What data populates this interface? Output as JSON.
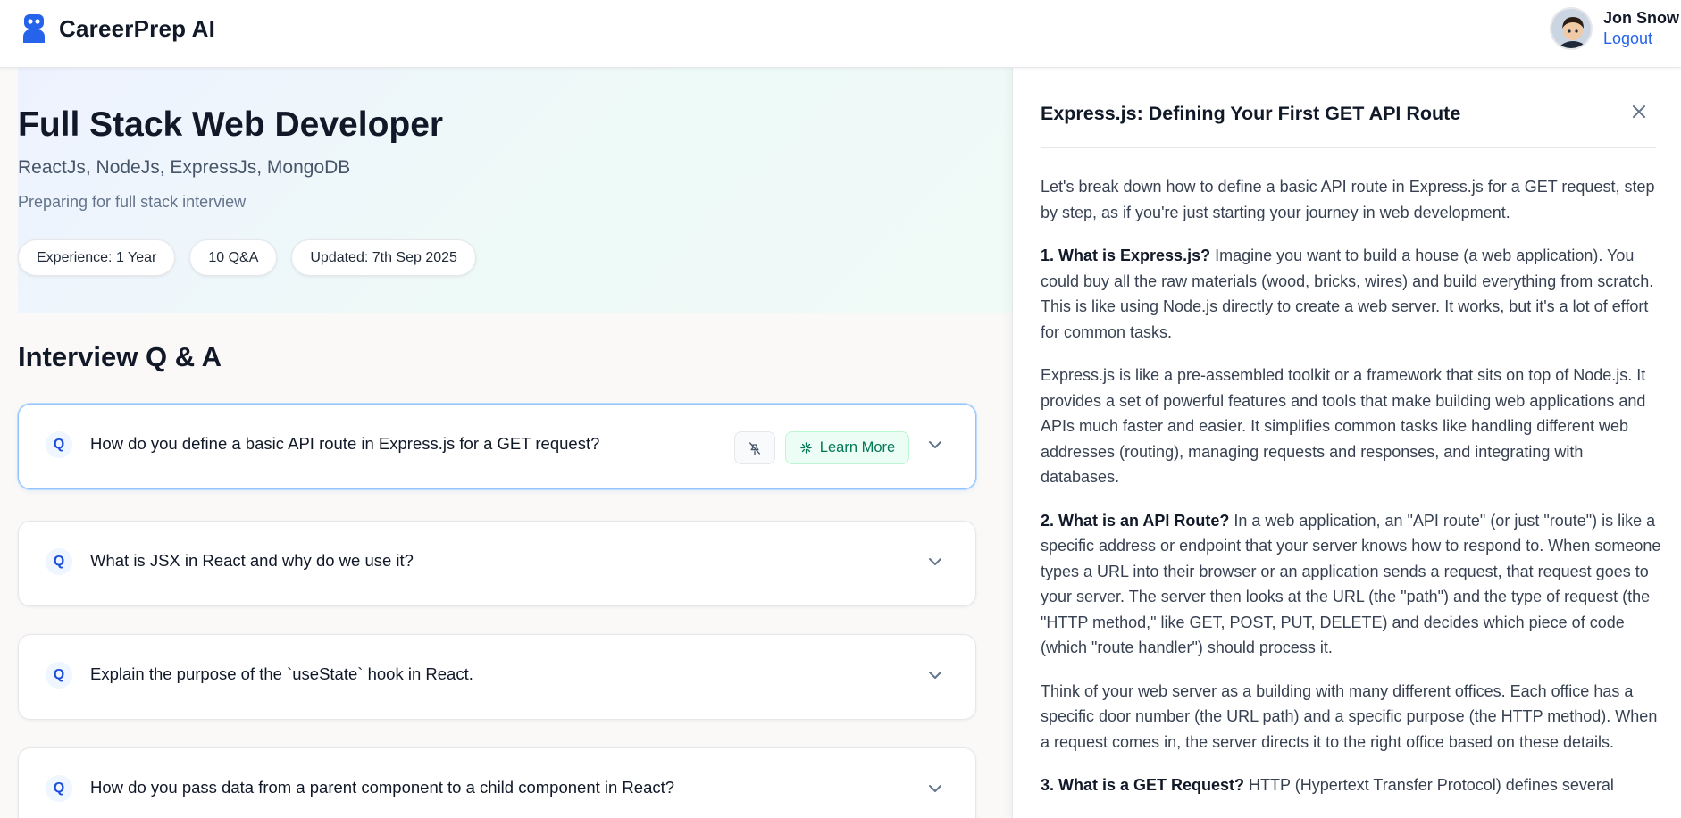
{
  "app": {
    "name": "CareerPrep AI"
  },
  "user": {
    "name": "Jon Snow",
    "logout_label": "Logout"
  },
  "session": {
    "role": "Full Stack Web Developer",
    "skills": "ReactJs, NodeJs, ExpressJs, MongoDB",
    "description": "Preparing for full stack interview",
    "chips": [
      "Experience: 1 Year",
      "10 Q&A",
      "Updated: 7th Sep 2025"
    ]
  },
  "qa": {
    "heading": "Interview Q & A",
    "badge": "Q",
    "learn_more_label": "Learn More",
    "items": [
      {
        "question": "How do you define a basic API route in Express.js for a GET request?"
      },
      {
        "question": "What is JSX in React and why do we use it?"
      },
      {
        "question": "Explain the purpose of the `useState` hook in React."
      },
      {
        "question": "How do you pass data from a parent component to a child component in React?"
      }
    ]
  },
  "drawer": {
    "title": "Express.js: Defining Your First GET API Route",
    "paragraphs": [
      {
        "lead": "",
        "text": "Let's break down how to define a basic API route in Express.js for a GET request, step by step, as if you're just starting your journey in web development."
      },
      {
        "lead": "1. What is Express.js?",
        "text": " Imagine you want to build a house (a web application). You could buy all the raw materials (wood, bricks, wires) and build everything from scratch. This is like using Node.js directly to create a web server. It works, but it's a lot of effort for common tasks."
      },
      {
        "lead": "",
        "text": "Express.js is like a pre-assembled toolkit or a framework that sits on top of Node.js. It provides a set of powerful features and tools that make building web applications and APIs much faster and easier. It simplifies common tasks like handling different web addresses (routing), managing requests and responses, and integrating with databases."
      },
      {
        "lead": "2. What is an API Route?",
        "text": " In a web application, an \"API route\" (or just \"route\") is like a specific address or endpoint that your server knows how to respond to. When someone types a URL into their browser or an application sends a request, that request goes to your server. The server then looks at the URL (the \"path\") and the type of request (the \"HTTP method,\" like GET, POST, PUT, DELETE) and decides which piece of code (which \"route handler\") should process it."
      },
      {
        "lead": "",
        "text": "Think of your web server as a building with many different offices. Each office has a specific door number (the URL path) and a specific purpose (the HTTP method). When a request comes in, the server directs it to the right office based on these details."
      },
      {
        "lead": "3. What is a GET Request?",
        "text": " HTTP (Hypertext Transfer Protocol) defines several"
      }
    ]
  },
  "colors": {
    "accent": "#2563eb",
    "learn_more": "#047857",
    "badge_bg": "#eff6ff"
  }
}
